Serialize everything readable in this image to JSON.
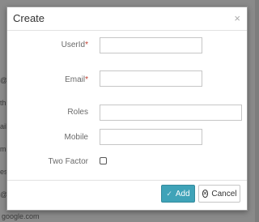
{
  "background": {
    "fragments": [
      "@",
      "th",
      "ail",
      "me",
      "es",
      "@",
      "google.com"
    ]
  },
  "modal": {
    "title": "Create",
    "close_glyph": "×",
    "fields": {
      "userid": {
        "label": "UserId",
        "required_mark": "*",
        "value": ""
      },
      "email": {
        "label": "Email",
        "required_mark": "*",
        "value": ""
      },
      "roles": {
        "label": "Roles",
        "value": ""
      },
      "mobile": {
        "label": "Mobile",
        "value": ""
      },
      "two_factor": {
        "label": "Two Factor",
        "checked": false
      }
    },
    "footer": {
      "add_label": "Add",
      "cancel_label": "Cancel"
    },
    "icons": {
      "add": "check-icon",
      "cancel": "cancel-icon",
      "close": "close-icon"
    }
  },
  "colors": {
    "accent": "#3fa3b8",
    "required": "#c0392b",
    "overlay": "#8a8a8a"
  }
}
